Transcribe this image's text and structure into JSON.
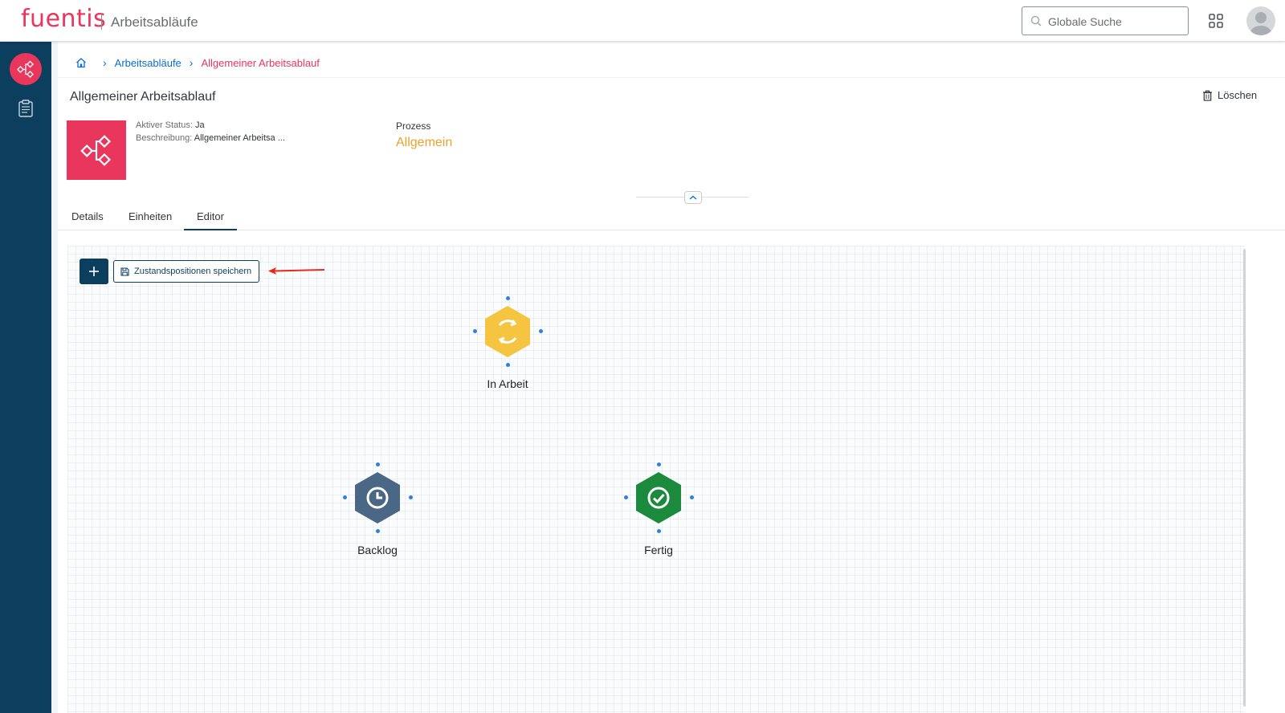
{
  "topbar": {
    "brand": "fuentis",
    "app_title": "Arbeitsabläufe",
    "search_placeholder": "Globale Suche"
  },
  "breadcrumb": {
    "items": [
      "Arbeitsabläufe",
      "Allgemeiner Arbeitsablauf"
    ]
  },
  "header": {
    "title": "Allgemeiner Arbeitsablauf",
    "delete_label": "Löschen",
    "attributes": [
      {
        "label": "Aktiver Status:",
        "value": "Ja"
      },
      {
        "label": "Beschreibung:",
        "value": "Allgemeiner Arbeitsa ..."
      }
    ],
    "process_label": "Prozess",
    "process_value": "Allgemein"
  },
  "tabs": [
    {
      "label": "Details",
      "selected": false
    },
    {
      "label": "Einheiten",
      "selected": false
    },
    {
      "label": "Editor",
      "selected": true
    }
  ],
  "editor": {
    "save_positions_label": "Zustandspositionen speichern",
    "nodes": [
      {
        "name": "In Arbeit",
        "color": "#f5c440",
        "icon": "in-progress-icon"
      },
      {
        "name": "Backlog",
        "color": "#4a6786",
        "icon": "clock-icon"
      },
      {
        "name": "Fertig",
        "color": "#1b8a3c",
        "icon": "checkmark-icon"
      }
    ]
  },
  "colors": {
    "brand": "#e8365d",
    "sidebar": "#0c3e5e",
    "link": "#0a6ed1",
    "process": "#e9a32b",
    "port": "#2f7fe0",
    "annotation_arrow": "#e8291c"
  }
}
